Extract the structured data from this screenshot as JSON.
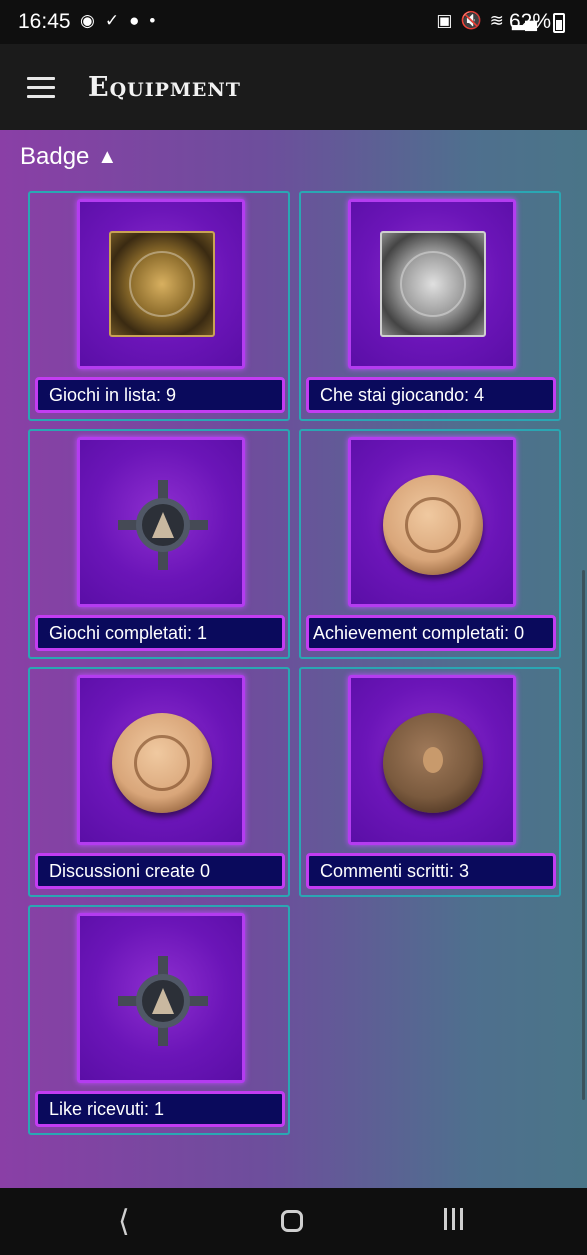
{
  "status_bar": {
    "time": "16:45",
    "left_icons": [
      "app-icon",
      "check-icon",
      "reddit-icon",
      "dot-icon"
    ],
    "right_icons": [
      "nfc-icon",
      "mute-icon",
      "wifi-icon",
      "signal-icon"
    ],
    "battery": "62%"
  },
  "app_bar": {
    "title": "Equipment",
    "menu_icon": "hamburger-menu-icon"
  },
  "section": {
    "title": "Badge",
    "toggle_icon": "▲"
  },
  "badges": [
    {
      "label": "Giochi in lista: 9",
      "icon": "gold-skull-plaque"
    },
    {
      "label": "Che stai giocando: 4",
      "icon": "silver-plaque"
    },
    {
      "label": "Giochi completati: 1",
      "icon": "dark-star-medal"
    },
    {
      "label": "Achievement completati: 0",
      "icon": "bronze-wreath-coin"
    },
    {
      "label": "Discussioni create 0",
      "icon": "bronze-wreath-coin"
    },
    {
      "label": "Commenti scritti: 3",
      "icon": "dark-bronze-coin"
    },
    {
      "label": "Like ricevuti: 1",
      "icon": "dark-star-medal"
    }
  ],
  "nav_bar": {
    "back_icon": "back-icon",
    "home_icon": "home-icon",
    "recents_icon": "recents-icon"
  }
}
